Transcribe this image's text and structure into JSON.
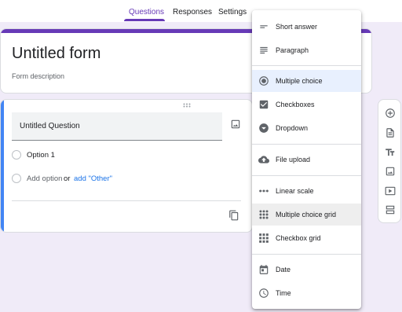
{
  "tabs": [
    {
      "label": "Questions",
      "active": true
    },
    {
      "label": "Responses",
      "active": false
    },
    {
      "label": "Settings",
      "active": false
    }
  ],
  "form": {
    "title": "Untitled form",
    "description_placeholder": "Form description"
  },
  "question": {
    "title": "Untitled Question",
    "options": [
      "Option 1"
    ],
    "add_option": "Add option",
    "or": "or",
    "add_other": "add \"Other\""
  },
  "menu": {
    "items": [
      {
        "label": "Short answer",
        "icon": "short-answer-icon"
      },
      {
        "label": "Paragraph",
        "icon": "paragraph-icon"
      },
      {
        "label": "Multiple choice",
        "icon": "radio-button-icon",
        "selected": true
      },
      {
        "label": "Checkboxes",
        "icon": "checkbox-icon"
      },
      {
        "label": "Dropdown",
        "icon": "dropdown-icon"
      },
      {
        "label": "File upload",
        "icon": "cloud-upload-icon"
      },
      {
        "label": "Linear scale",
        "icon": "linear-scale-icon"
      },
      {
        "label": "Multiple choice grid",
        "icon": "grid-dots-icon",
        "hovered": true
      },
      {
        "label": "Checkbox grid",
        "icon": "grid-squares-icon"
      },
      {
        "label": "Date",
        "icon": "calendar-icon"
      },
      {
        "label": "Time",
        "icon": "clock-icon"
      }
    ]
  },
  "side_toolbar": [
    "add-question-icon",
    "import-questions-icon",
    "add-title-icon",
    "add-image-icon",
    "add-video-icon",
    "add-section-icon"
  ],
  "colors": {
    "accent": "#673ab7",
    "question_bar": "#4285f4",
    "link": "#1a73e8",
    "background": "#f0ebf8",
    "selected_item": "#e8f0fe"
  }
}
